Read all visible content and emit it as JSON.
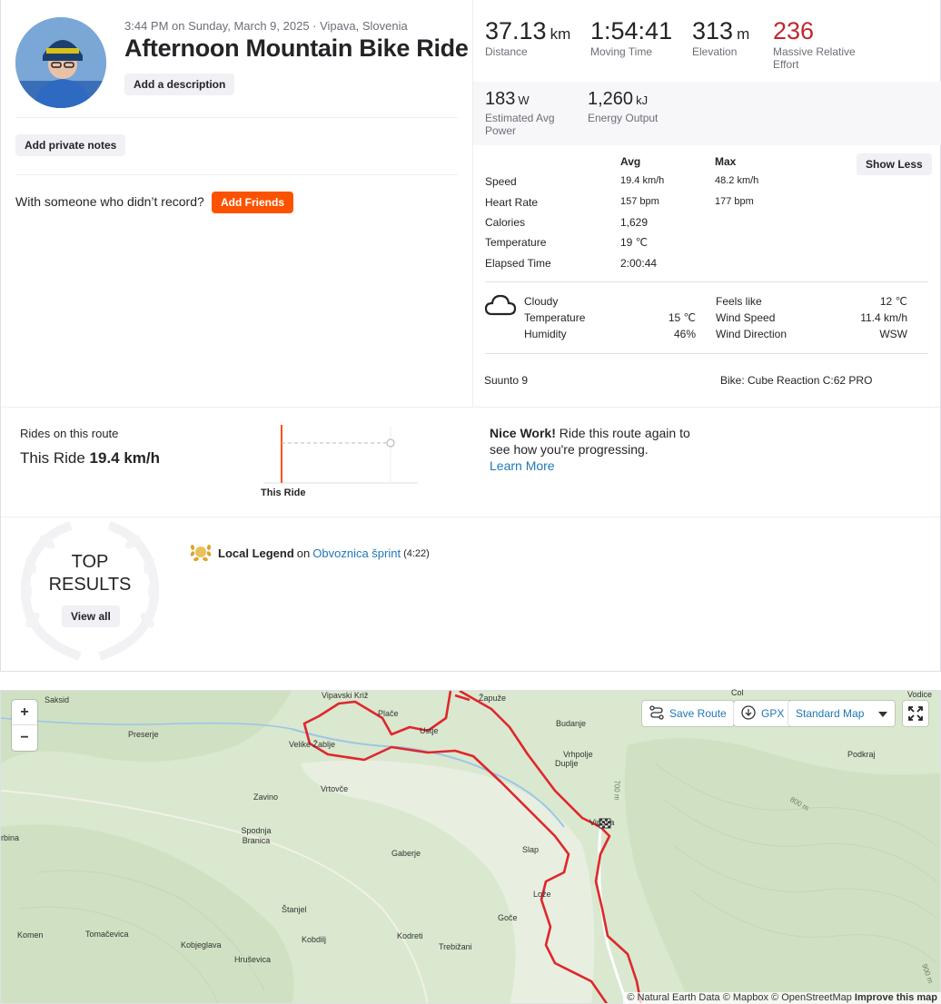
{
  "activity": {
    "meta_line": "3:44 PM on Sunday, March 9, 2025 · Vipava, Slovenia",
    "title": "Afternoon Mountain Bike Ride",
    "add_description": "Add a description",
    "add_private_notes": "Add private notes",
    "with_someone": "With someone who didn’t record?",
    "add_friends": "Add Friends"
  },
  "primary_stats": [
    {
      "value": "37.13",
      "unit": "km",
      "label": "Distance"
    },
    {
      "value": "1:54:41",
      "unit": "",
      "label": "Moving Time"
    },
    {
      "value": "313",
      "unit": "m",
      "label": "Elevation"
    },
    {
      "value": "236",
      "unit": "",
      "label": "Massive Relative Effort"
    }
  ],
  "secondary_stats": [
    {
      "value": "183",
      "unit": "W",
      "label": "Estimated Avg Power"
    },
    {
      "value": "1,260",
      "unit": "kJ",
      "label": "Energy Output"
    }
  ],
  "detail_table": {
    "col_avg": "Avg",
    "col_max": "Max",
    "show_less": "Show Less",
    "rows": [
      {
        "label": "Speed",
        "avg": "19.4 km/h",
        "max": "48.2 km/h"
      },
      {
        "label": "Heart Rate",
        "avg": "157 bpm",
        "max": "177 bpm"
      },
      {
        "label": "Calories",
        "avg": "1,629",
        "max": ""
      },
      {
        "label": "Temperature",
        "avg": "19 ℃",
        "max": ""
      },
      {
        "label": "Elapsed Time",
        "avg": "2:00:44",
        "max": ""
      }
    ]
  },
  "weather": {
    "condition": "Cloudy",
    "temperature_label": "Temperature",
    "temperature": "15 ℃",
    "humidity_label": "Humidity",
    "humidity": "46%",
    "feels_like_label": "Feels like",
    "feels_like": "12 ℃",
    "wind_speed_label": "Wind Speed",
    "wind_speed": "11.4 km/h",
    "wind_dir_label": "Wind Direction",
    "wind_dir": "WSW"
  },
  "device": "Suunto 9",
  "bike": "Bike: Cube Reaction C:62 PRO",
  "route": {
    "label": "Rides on this route",
    "this_ride_label": "This Ride",
    "this_ride_value": "19.4 km/h",
    "chart_caption": "This Ride",
    "nice_work_bold": "Nice Work!",
    "nice_work_text": " Ride this route again to see how you're progressing.",
    "learn_more": "Learn More"
  },
  "top_results": {
    "title": "TOP RESULTS",
    "view_all": "View all",
    "achievement_title": "Local Legend",
    "achievement_on": "on",
    "segment": "Obvoznica šprint",
    "time": "(4:22)"
  },
  "map": {
    "save_route": "Save Route",
    "gpx": "GPX",
    "map_style": "Standard Map",
    "zoom_in": "+",
    "zoom_out": "−",
    "attribution": "© Natural Earth Data © Mapbox © OpenStreetMap",
    "improve": "Improve this map",
    "route_color": "#e0262c",
    "places": [
      "Saksid",
      "Vipavski Križ",
      "Plače",
      "Ustje",
      "Žapuže",
      "Col",
      "Vodice",
      "Preserje",
      "Velike Žablje",
      "Budanje",
      "Vrhpolje",
      "Podkraj",
      "Duplje",
      "Zavino",
      "Vrtovče",
      "Vipava",
      "Spodnja Branica",
      "Gaberje",
      "Slap",
      "rbina",
      "Lože",
      "Štanjel",
      "Goče",
      "Komen",
      "Tomačevica",
      "Kobjeglava",
      "Kobdilj",
      "Kodreti",
      "Trebižani",
      "Hruševica",
      "800 m",
      "700 m",
      "900 m"
    ]
  },
  "colors": {
    "accent": "#fc5200",
    "effort": "#c0262d",
    "link": "#1f78b4"
  }
}
